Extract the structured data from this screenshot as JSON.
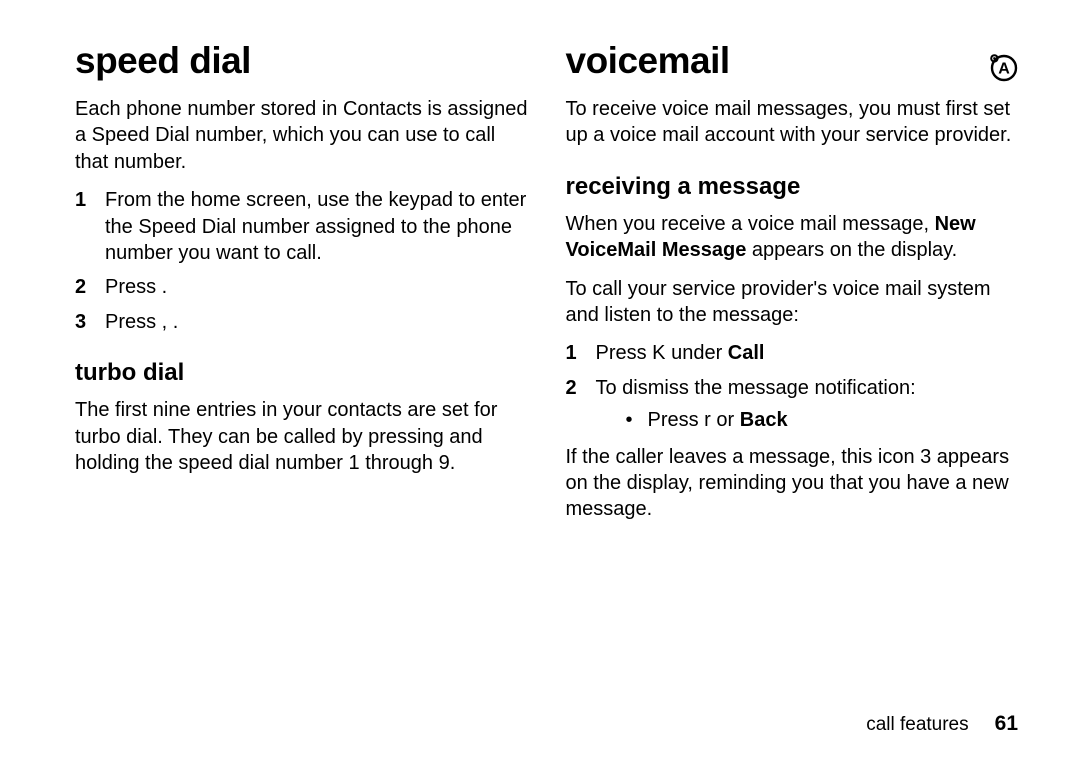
{
  "left": {
    "h1": "speed dial",
    "intro": "Each phone number stored in Contacts is assigned a Speed Dial number, which you can use to call that number.",
    "steps": [
      "From the home screen, use the keypad to enter the Speed Dial number assigned to the phone number you want to call.",
      "Press      .",
      "Press  ,   ."
    ],
    "h2": "turbo dial",
    "turbo_text": "The first nine entries in your contacts are set for turbo dial. They can be called by pressing and holding the speed dial number 1 through 9."
  },
  "right": {
    "h1": "voicemail",
    "intro": "To receive voice mail messages, you must first set up a voice mail account with your service provider.",
    "h2": "receiving a message",
    "recv_prefix": "When you receive a voice mail message, ",
    "recv_bold": "New VoiceMail Message",
    "recv_suffix": " appears on the display.",
    "tocall": "To call your service provider's voice mail system and listen to the message:",
    "step1_prefix": "Press  K   under ",
    "step1_bold": "Call",
    "step2": "To dismiss the message notification:",
    "bullet_prefix": "Press r     or ",
    "bullet_bold": "Back",
    "after_prefix": "If the caller leaves a message, this icon ",
    "after_icon": "3",
    "after_suffix": " appears on the display, reminding you that you have a new message."
  },
  "footer": {
    "section": "call features",
    "page": "61"
  },
  "icons": {
    "voicemail_badge": "voicemail-icon"
  }
}
